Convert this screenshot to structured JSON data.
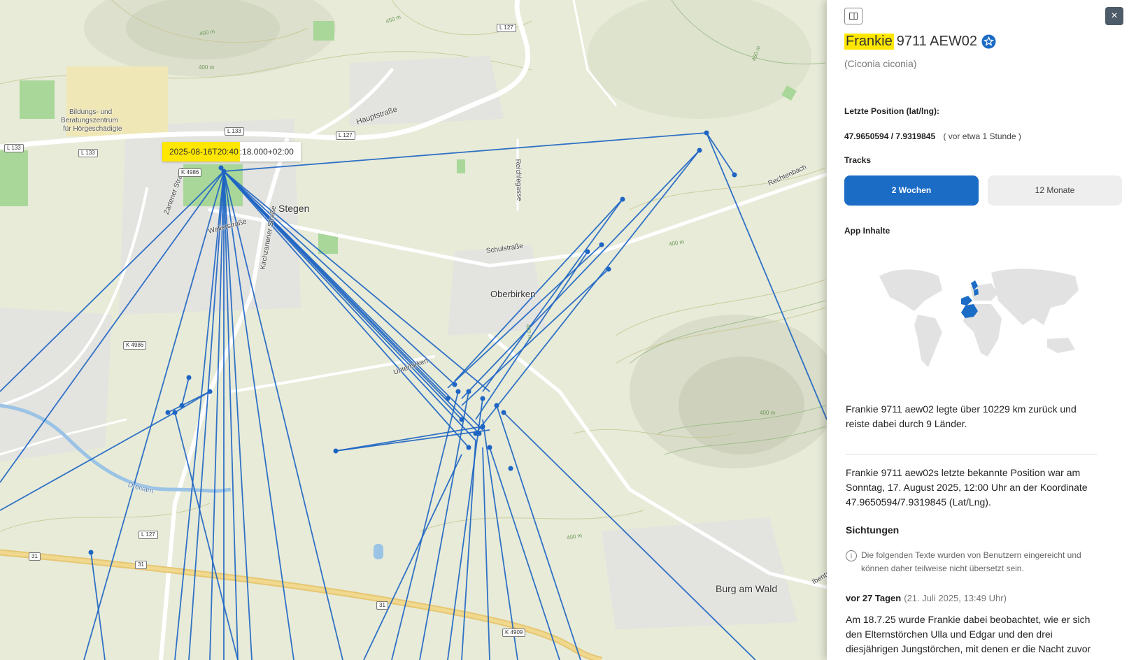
{
  "map": {
    "tooltip_highlight": "2025-08-16T20:40",
    "tooltip_rest": ":18.000+02:00",
    "places": [
      "Stegen",
      "Oberbirken",
      "Burg am Wald",
      "Bildungs- und",
      "Beratungszentrum",
      "für Hörgeschädigte",
      "Hauptstraße",
      "Reichlegasse",
      "Rechtenbach",
      "Schulstraße",
      "Unterbirken",
      "Wallerstraße",
      "Zartener Straße",
      "Kirchzartener Straße",
      "Dreisam",
      "Ibentalstr."
    ],
    "roads": [
      "L 127",
      "L 133",
      "L 133",
      "L 133",
      "L 127",
      "K 4986",
      "K 4986",
      "L 127",
      "31",
      "31",
      "31",
      "K 4909"
    ],
    "contours": [
      "450 m",
      "400 m",
      "400 m",
      "450 m",
      "400 m",
      "400 m",
      "400 m",
      "400 m"
    ],
    "track_color": "#1d64c4"
  },
  "panel": {
    "toggle_icon": "sidebar-toggle-icon",
    "close_label": "×",
    "name_highlight": "Frankie",
    "name_rest": "9711 AEW02",
    "latin": "(Ciconia ciconia)",
    "last_pos_label": "Letzte Position (lat/lng):",
    "coords": "47.9650594 / 7.9319845",
    "coords_ago": "( vor etwa 1 Stunde )",
    "tracks_label": "Tracks",
    "tab_2w": "2 Wochen",
    "tab_12m": "12 Monate",
    "app_label": "App Inhalte",
    "para1": "Frankie 9711 aew02 legte über 10229 km zurück und reiste dabei durch 9 Länder.",
    "para2": "Frankie 9711 aew02s letzte bekannte Position war am Sonntag, 17. August 2025, 12:00 Uhr an der Koordinate 47.9650594/7.9319845 (Lat/Lng).",
    "sightings_title": "Sichtungen",
    "info_text": "Die folgenden Texte wurden von Benutzern eingereicht und können daher teilweise nicht übersetzt sein.",
    "sight_ago": "vor 27 Tagen",
    "sight_date": "(21. Juli 2025, 13:49 Uhr)",
    "sight_text": "Am 18.7.25 wurde Frankie dabei beobachtet, wie er sich den Elternstörchen Ulla und Edgar und den drei diesjährigen Jungstörchen, mit denen er die Nacht zuvor",
    "accent": "#1b6cc5",
    "highlight": "#ffe700"
  }
}
